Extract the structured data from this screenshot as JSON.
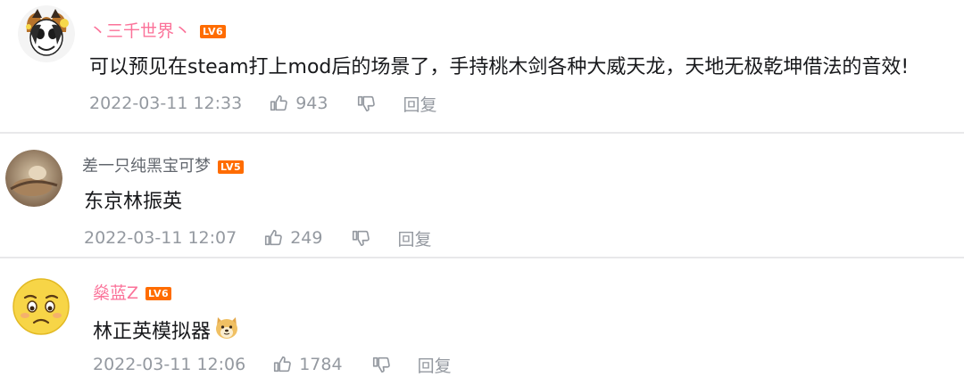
{
  "theme": {
    "pink": "#fb7299",
    "grey_text": "#9499a0",
    "divider": "#e8e8ea",
    "badge_lv6": "#ff6c00",
    "badge_lv5": "#ff6c00"
  },
  "comments": [
    {
      "username": "丶三千世界丶",
      "username_color": "#fb7299",
      "level": "LV6",
      "content": "可以预见在steam打上mod后的场景了，手持桃木剑各种大威天龙，天地无极乾坤借法的音效!",
      "time": "2022-03-11 12:33",
      "likes": "943",
      "reply_label": "回复",
      "avatar_icon": "joker-cat-avatar"
    },
    {
      "username": "差一只纯黑宝可梦",
      "username_color": "#61666d",
      "level": "LV5",
      "content": "东京林振英",
      "time": "2022-03-11 12:07",
      "likes": "249",
      "reply_label": "回复",
      "avatar_icon": "photo-avatar"
    },
    {
      "username": "燊蓝Z",
      "username_color": "#fb7299",
      "level": "LV6",
      "content": "林正英模拟器",
      "time": "2022-03-11 12:06",
      "likes": "1784",
      "reply_label": "回复",
      "avatar_icon": "sad-face-avatar",
      "emoji_icon": "doge-emoji"
    }
  ]
}
